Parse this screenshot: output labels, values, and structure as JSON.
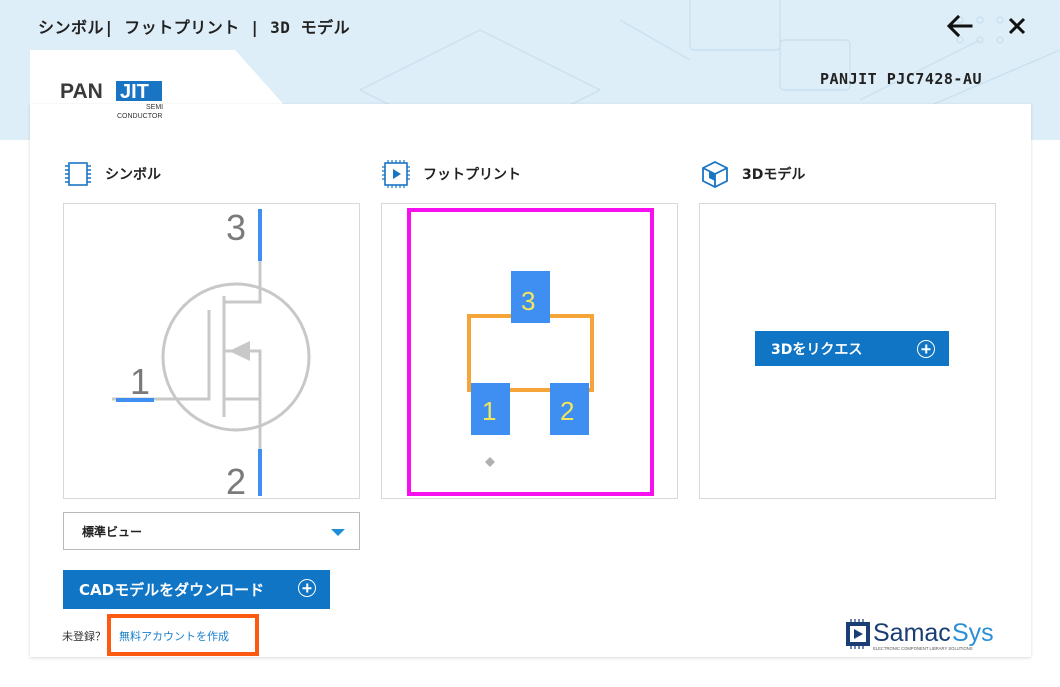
{
  "header": {
    "title": "シンボル| フットプリント | 3D モデル"
  },
  "part": {
    "name": "PANJIT PJC7428-AU"
  },
  "logo": {
    "brand": "PANJIT",
    "tagline_1": "SEMI",
    "tagline_2": "CONDUCTOR"
  },
  "sections": {
    "symbol": {
      "label": "シンボル"
    },
    "footprint": {
      "label": "フットプリント"
    },
    "model3d": {
      "label": "3Dモデル"
    }
  },
  "symbol_pins": {
    "pin1": "1",
    "pin2": "2",
    "pin3": "3"
  },
  "footprint_pads": {
    "pad1": "1",
    "pad2": "2",
    "pad3": "3"
  },
  "view_select": {
    "value": "標準ビュー"
  },
  "buttons": {
    "request_3d": "3Dをリクエス",
    "download_cad": "CADモデルをダウンロード"
  },
  "signup": {
    "prompt": "未登録？",
    "link": "無料アカウントを作成"
  },
  "footer_brand": {
    "name_1": "Samac",
    "name_2": "Sys",
    "tagline": "ELECTRONIC COMPONENT LIBRARY SOLUTIONS"
  },
  "colors": {
    "accent_blue": "#0f75c4",
    "pad_blue": "#3f8ef2",
    "outline_orange": "#f5a437",
    "highlight_magenta": "#f70ff0",
    "signup_highlight": "#fb5a10"
  },
  "icons": {
    "back": "arrow-left-icon",
    "close": "close-icon",
    "symbol": "symbol-chip-icon",
    "footprint": "footprint-chip-icon",
    "model3d": "cube-icon",
    "plus": "plus-circle-icon",
    "dropdown": "chevron-down-icon"
  }
}
